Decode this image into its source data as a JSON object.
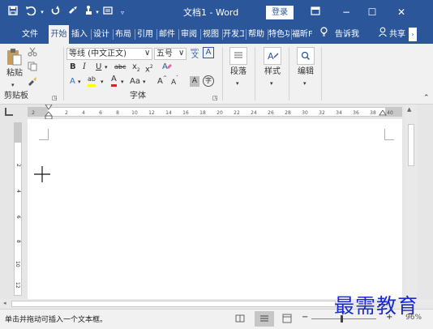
{
  "titlebar": {
    "doc_title": "文档1 - Word",
    "login": "登录",
    "ribbon_display_icon": "ribbon-display-icon",
    "minimize": "−",
    "restore": "☐",
    "close": "✕"
  },
  "tabs": [
    {
      "label": "文件"
    },
    {
      "label": "开始"
    },
    {
      "label": "插入"
    },
    {
      "label": "设计"
    },
    {
      "label": "布局"
    },
    {
      "label": "引用"
    },
    {
      "label": "邮件"
    },
    {
      "label": "审阅"
    },
    {
      "label": "视图"
    },
    {
      "label": "开发工"
    },
    {
      "label": "帮助"
    },
    {
      "label": "特色功"
    },
    {
      "label": "福昕F"
    },
    {
      "label": "告诉我"
    },
    {
      "label": "共享"
    }
  ],
  "ribbon": {
    "clipboard": {
      "paste": "粘贴",
      "group": "剪贴板"
    },
    "font": {
      "name": "等线 (中文正文)",
      "size": "五号",
      "wen": "wén",
      "wen_char": "文",
      "box_a": "A",
      "bold": "B",
      "italic": "I",
      "underline": "U",
      "strike": "abc",
      "sub": "x",
      "sub_mark": "2",
      "sup": "x",
      "sup_mark": "2",
      "text_effect": "A",
      "highlight": "ab",
      "font_color": "A",
      "change_case": "Aa",
      "grow": "A",
      "shrink": "A",
      "shade": "A",
      "circle": "字",
      "group": "字体"
    },
    "paragraph": "段落",
    "styles": "样式",
    "editing": "编辑"
  },
  "ruler": {
    "numbers": [
      "2",
      "2",
      "4",
      "6",
      "8",
      "10",
      "12",
      "14",
      "16",
      "18",
      "20",
      "22",
      "24",
      "26",
      "28",
      "30",
      "32",
      "34",
      "36",
      "38",
      "40"
    ],
    "vnumbers": [
      "2",
      "4",
      "6",
      "8",
      "10",
      "12"
    ]
  },
  "status": {
    "text": "单击并拖动可插入一个文本框。",
    "zoom": "96%"
  },
  "watermark": "最需教育"
}
